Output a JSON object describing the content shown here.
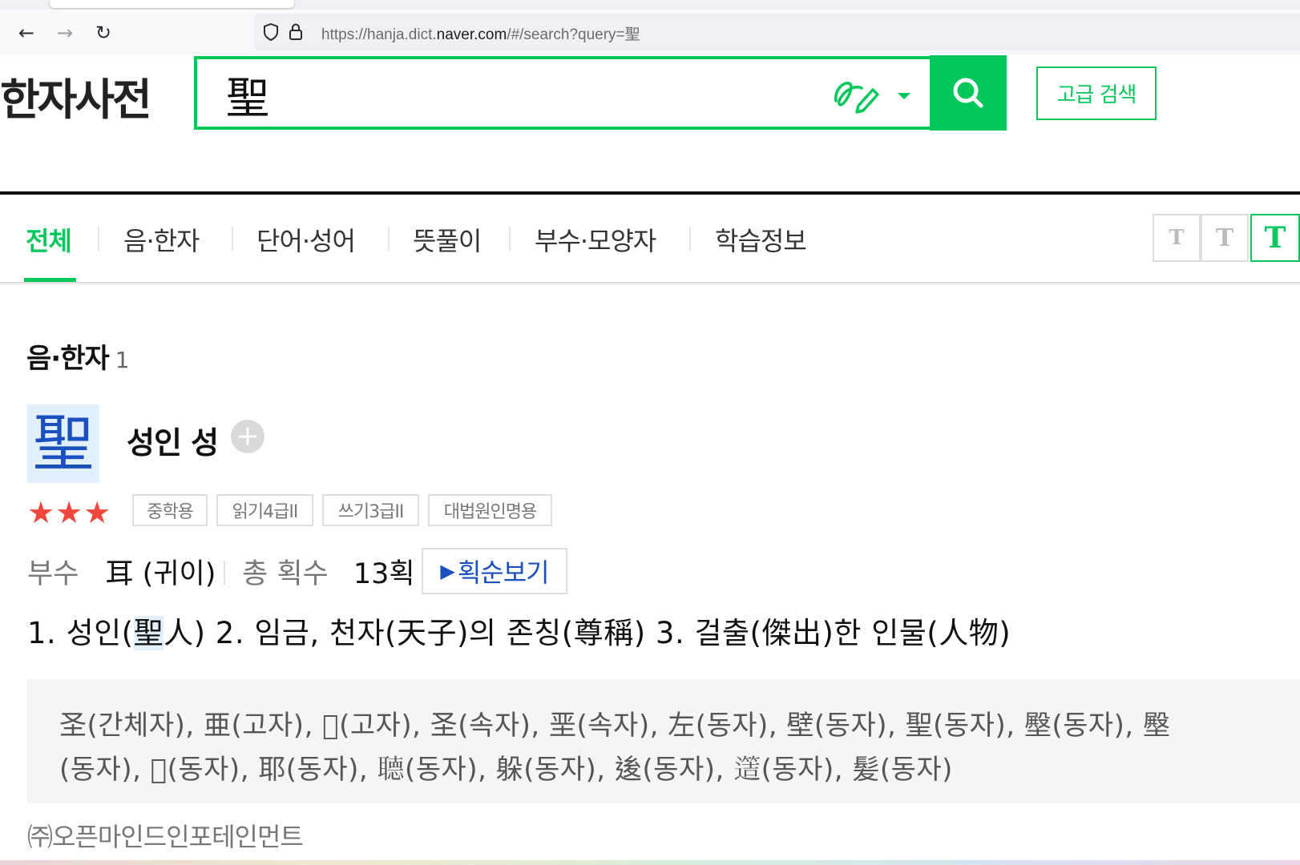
{
  "browser": {
    "url_prefix": "https://hanja.dict.",
    "url_domain": "naver.com",
    "url_suffix": "/#/search?query=聖"
  },
  "header": {
    "logo": "한자사전",
    "search_value": "聖",
    "advanced_search_label": "고급 검색"
  },
  "tabs": [
    {
      "label": "전체",
      "active": true
    },
    {
      "label": "음·한자"
    },
    {
      "label": "단어·성어"
    },
    {
      "label": "뜻풀이"
    },
    {
      "label": "부수·모양자"
    },
    {
      "label": "학습정보"
    }
  ],
  "font_size_buttons": [
    "T",
    "T",
    "T"
  ],
  "section": {
    "title": "음·한자",
    "count": "1"
  },
  "entry": {
    "hanja": "聖",
    "meaning": "성인 성",
    "star_glyphs": "★★★",
    "star_count": 3,
    "badges": [
      "중학용",
      "읽기4급II",
      "쓰기3급II",
      "대법원인명용"
    ],
    "radical_label": "부수",
    "radical_value": "耳 (귀이)",
    "strokes_label": "총 획수",
    "strokes_value": "13획",
    "stroke_order_label": "획순보기",
    "definitions_pre": "1. 성인(",
    "definitions_hl": "聖",
    "definitions_post": "人)  2. 임금, 천자(天子)의 존칭(尊稱)  3. 걸출(傑出)한 인물(人物)",
    "variants_line1": "圣(간체자), 亜(고자), 𦔳(고자), 圣(속자), 垩(속자), 左(동자), 壁(동자), 聖(동자), 壂(동자), 壂",
    "variants_line2": "(동자), 𦔳(동자), 耶(동자), 𦗟(동자), 躲(동자), 𨒥(동자), 𨗡(동자), 髪(동자)"
  },
  "footer": {
    "copyright": "㈜오픈마인드인포테인먼트"
  },
  "colors": {
    "accent": "#03c75a",
    "hanja_blue": "#1a4fbf",
    "star": "#f0473d"
  }
}
